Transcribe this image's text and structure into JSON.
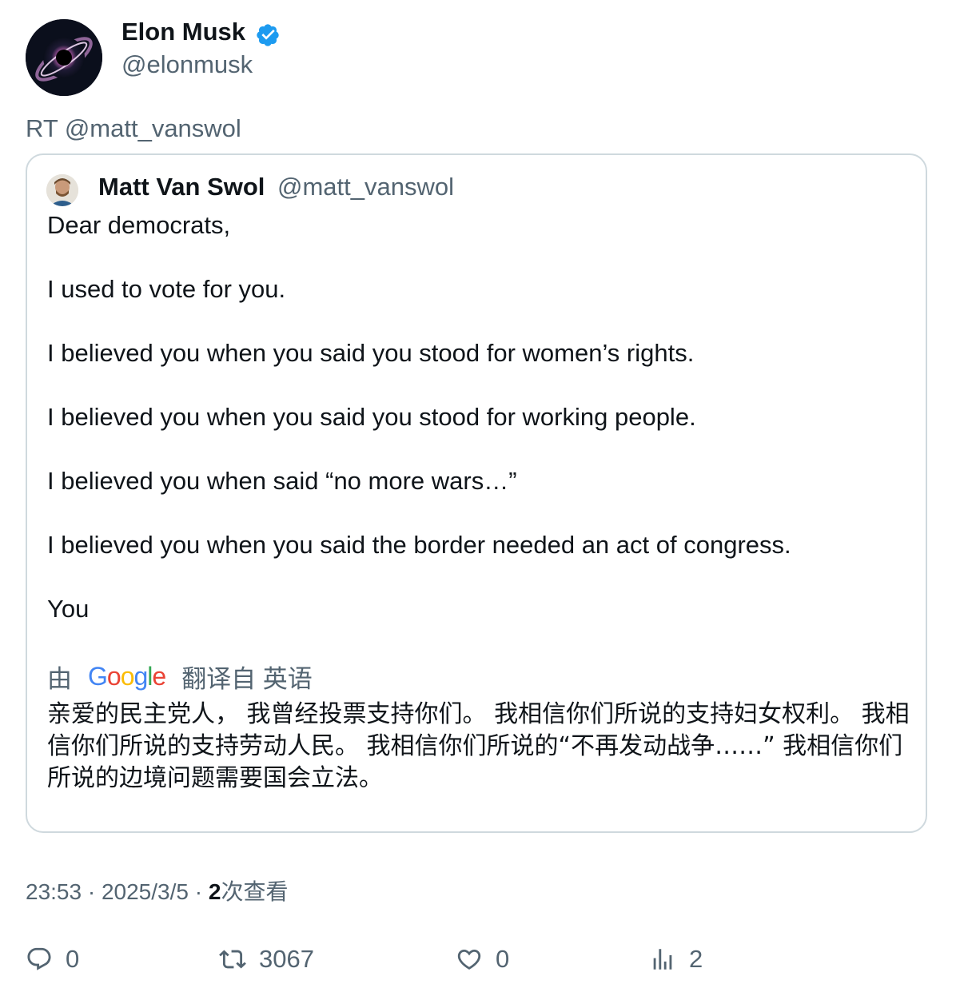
{
  "tweet": {
    "author_name": "Elon Musk",
    "author_handle": "@elonmusk",
    "retweet_line": "RT @matt_vanswol",
    "quote": {
      "author_name": "Matt Van Swol",
      "author_handle": "@matt_vanswol",
      "lines": [
        "Dear democrats,",
        "I used to vote for you.",
        "I believed you when you said you stood for women’s rights.",
        "I believed you when you said you stood for working people.",
        "I believed you when said “no more wars…”",
        "I believed you when you said the border needed an act of congress.",
        "You"
      ],
      "translate_prefix": "由",
      "translate_provider": "Google",
      "translate_suffix": "翻译自 英语",
      "translated_text": "亲爱的民主党人， 我曾经投票支持你们。 我相信你们所说的支持妇女权利。 我相信你们所说的支持劳动人民。 我相信你们所说的“不再发动战争……” 我相信你们所说的边境问题需要国会立法。"
    },
    "time": "23:53",
    "date": "2025/3/5",
    "views_count": "2",
    "views_label": "次查看",
    "separator": "·",
    "actions": {
      "replies": "0",
      "retweets": "3067",
      "likes": "0",
      "views": "2"
    }
  },
  "colors": {
    "text_primary": "#0f1419",
    "text_secondary": "#536471",
    "border": "#cfd9de",
    "verified": "#1d9bf0"
  },
  "icons": {
    "verified": "verified-badge-icon",
    "reply": "reply-icon",
    "retweet": "retweet-icon",
    "like": "heart-icon",
    "views": "analytics-icon"
  }
}
